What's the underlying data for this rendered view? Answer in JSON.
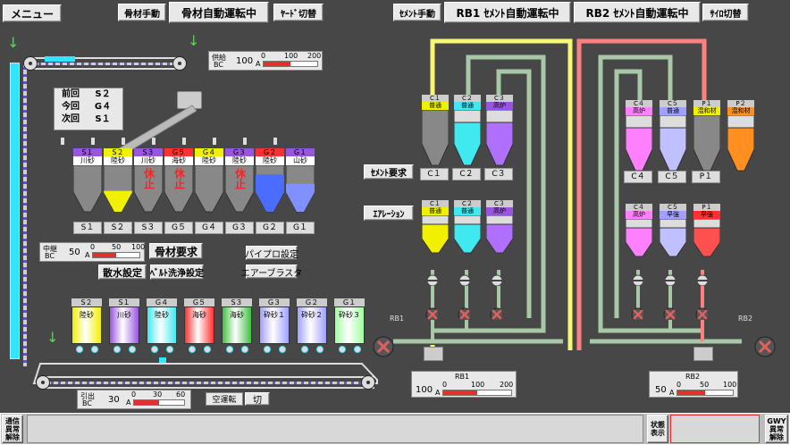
{
  "topbar": {
    "menu": "メニュー",
    "agg_manual": "骨材手動",
    "agg_auto_status": "骨材自動運転中",
    "yard_switch": "ﾔｰﾄﾞ切替",
    "cement_manual": "ｾﾒﾝﾄ手動",
    "rb1_status": "RB1 ｾﾒﾝﾄ自動運転中",
    "rb2_status": "RB2 ｾﾒﾝﾄ自動運転中",
    "silo_switch": "ｻｲﾛ切替"
  },
  "supply_bc": {
    "label_a": "供給",
    "label_b": "BC",
    "value": "100",
    "unit": "A",
    "scale": [
      "0",
      "100",
      "200"
    ],
    "level": 0.5
  },
  "middle_bc": {
    "label_a": "中継",
    "label_b": "BC",
    "value": "50",
    "unit": "A",
    "scale": [
      "0",
      "50",
      "100"
    ],
    "level": 0.5
  },
  "pull_bc": {
    "label_a": "引出",
    "label_b": "BC",
    "value": "30",
    "unit": "A",
    "scale": [
      "0",
      "30",
      "60"
    ],
    "level": 0.5
  },
  "rb1_gauge": {
    "title": "RB1",
    "value": "100",
    "unit": "A",
    "scale": [
      "0",
      "100",
      "200"
    ],
    "level": 0.5
  },
  "rb2_gauge": {
    "title": "RB2",
    "value": "50",
    "unit": "A",
    "scale": [
      "0",
      "50",
      "100"
    ],
    "level": 0.5
  },
  "sequence": [
    {
      "label": "前回",
      "value": "S２"
    },
    {
      "label": "今回",
      "value": "G４"
    },
    {
      "label": "次回",
      "value": "S１"
    }
  ],
  "upper_bins": [
    {
      "id": "S１",
      "mat": "川砂",
      "color": "#9a55e0",
      "fill": "#888",
      "level": 0
    },
    {
      "id": "S２",
      "mat": "陸砂",
      "color": "#f0f000",
      "fill": "#f0f000",
      "level": 0.45
    },
    {
      "id": "S３",
      "mat": "川砂",
      "color": "#9a55e0",
      "fill": "#888",
      "level": 0,
      "stop": "休止"
    },
    {
      "id": "G５",
      "mat": "海砂",
      "color": "#ff3030",
      "fill": "#888",
      "level": 0,
      "stop": "休止"
    },
    {
      "id": "G４",
      "mat": "陸砂",
      "color": "#f0f000",
      "fill": "#888",
      "level": 0
    },
    {
      "id": "G３",
      "mat": "陸砂",
      "color": "#9a55e0",
      "fill": "#888",
      "level": 0,
      "stop": "休止"
    },
    {
      "id": "G２",
      "mat": "陸砂",
      "color": "#ff3030",
      "fill": "#4a6cff",
      "level": 0.8
    },
    {
      "id": "G１",
      "mat": "山砂",
      "color": "#9a55e0",
      "fill": "#8090ff",
      "level": 0.6
    }
  ],
  "upper_bin_tags": [
    "S１",
    "S２",
    "S３",
    "G５",
    "G４",
    "G３",
    "G２",
    "G１"
  ],
  "lower_bins": [
    {
      "id": "S２",
      "mat": "陸砂",
      "color": "#f0f000"
    },
    {
      "id": "S１",
      "mat": "川砂",
      "color": "#9a55e0"
    },
    {
      "id": "G４",
      "mat": "陸砂",
      "color": "#40e8f0"
    },
    {
      "id": "G５",
      "mat": "海砂",
      "color": "#ff3030"
    },
    {
      "id": "S３",
      "mat": "海砂",
      "color": "#40c040"
    },
    {
      "id": "G３",
      "mat": "砕砂１",
      "color": "#a0a0ff"
    },
    {
      "id": "G２",
      "mat": "砕砂２",
      "color": "#a0a0ff"
    },
    {
      "id": "G１",
      "mat": "砕砂３",
      "color": "#a0ffa0"
    }
  ],
  "buttons": {
    "agg_request": "骨材要求",
    "sprinkle": "散水設定",
    "belt_wash": "ﾍﾞﾙﾄ洗浄設定",
    "pipe_pro": "パイプロ設定",
    "air_blaster": "エアーブラスタ",
    "cement_request": "ｾﾒﾝﾄ要求",
    "aeration": "ｴｱﾚｰｼｮﾝ",
    "idle_label": "空運転",
    "idle_value": "切"
  },
  "cement_upper": [
    {
      "id": "C１",
      "mat": "普通",
      "color": "#f0f000",
      "body": "#888"
    },
    {
      "id": "C２",
      "mat": "普通",
      "color": "#40e8f0",
      "body": "#40e8f0"
    },
    {
      "id": "C３",
      "mat": "高炉",
      "color": "#9a55e0",
      "body": "#b070ff"
    }
  ],
  "cement_upper_tags": [
    "C１",
    "C２",
    "C３"
  ],
  "cement_upper_r": [
    {
      "id": "C４",
      "mat": "高炉",
      "color": "#ff80ff",
      "body": "#ff80ff"
    },
    {
      "id": "C５",
      "mat": "普通",
      "color": "#a0a0ff",
      "body": "#c0c0ff"
    },
    {
      "id": "P１",
      "mat": "混和材",
      "color": "#f0f000",
      "body": "#888"
    },
    {
      "id": "P２",
      "mat": "混和材",
      "color": "#ff9020",
      "body": "#ff9020"
    }
  ],
  "cement_upper_r_tags": [
    "C４",
    "C５",
    "P１"
  ],
  "cement_lower": [
    {
      "id": "C１",
      "mat": "普通",
      "color": "#f0f000",
      "body": "#f0f000"
    },
    {
      "id": "C２",
      "mat": "普通",
      "color": "#40e8f0",
      "body": "#40e8f0"
    },
    {
      "id": "C３",
      "mat": "高炉",
      "color": "#9a55e0",
      "body": "#b070ff"
    }
  ],
  "cement_lower_r": [
    {
      "id": "C４",
      "mat": "高炉",
      "color": "#ff80ff",
      "body": "#ff80ff"
    },
    {
      "id": "C５",
      "mat": "早強",
      "color": "#a0a0ff",
      "body": "#c0c0ff"
    },
    {
      "id": "P１",
      "mat": "早強",
      "color": "#ff3030",
      "body": "#ff5050"
    }
  ],
  "rb1_label": "RB1",
  "rb2_label": "RB2",
  "status": {
    "left": [
      "通信",
      "異常",
      "解除"
    ],
    "mid": [
      "状態",
      "表示"
    ],
    "right": [
      "GWY",
      "異常",
      "解除"
    ]
  },
  "colors": {
    "yellow_pipe": "#f8f870",
    "red_pipe": "#ff8080",
    "green_pipe": "#a8c8a8"
  }
}
